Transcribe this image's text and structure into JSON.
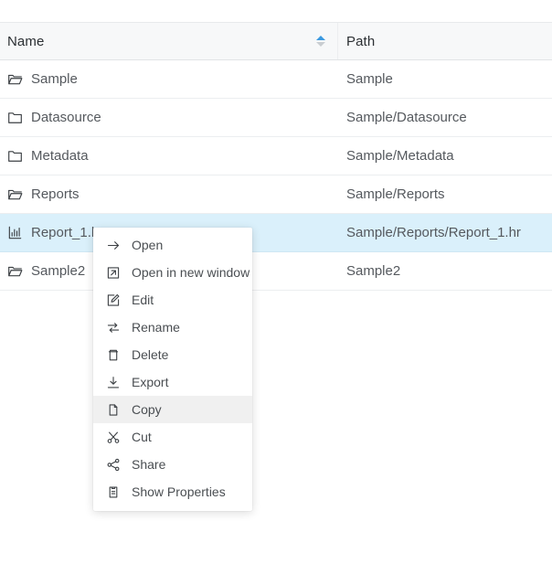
{
  "table": {
    "columns": [
      {
        "key": "name",
        "label": "Name",
        "sort_icon": "sort-asc-desc-icon",
        "sort_active_direction": "asc"
      },
      {
        "key": "path",
        "label": "Path"
      }
    ],
    "rows": [
      {
        "icon": "folder-open-icon",
        "indent": 0,
        "name": "Sample",
        "path": "Sample",
        "selected": false
      },
      {
        "icon": "folder-icon",
        "indent": 1,
        "name": "Datasource",
        "path": "Sample/Datasource",
        "selected": false
      },
      {
        "icon": "folder-icon",
        "indent": 1,
        "name": "Metadata",
        "path": "Sample/Metadata",
        "selected": false
      },
      {
        "icon": "folder-open-icon",
        "indent": 1,
        "name": "Reports",
        "path": "Sample/Reports",
        "selected": false
      },
      {
        "icon": "report-chart-icon",
        "indent": 2,
        "name": "Report_1.hr",
        "path": "Sample/Reports/Report_1.hr",
        "selected": true
      },
      {
        "icon": "folder-open-icon",
        "indent": 0,
        "name": "Sample2",
        "path": "Sample2",
        "selected": false
      }
    ]
  },
  "context_menu": {
    "items": [
      {
        "icon": "arrow-right-icon",
        "label": "Open",
        "hovered": false
      },
      {
        "icon": "open-new-window-icon",
        "label": "Open in new window",
        "hovered": false
      },
      {
        "icon": "edit-pencil-icon",
        "label": "Edit",
        "hovered": false
      },
      {
        "icon": "rename-icon",
        "label": "Rename",
        "hovered": false
      },
      {
        "icon": "trash-icon",
        "label": "Delete",
        "hovered": false
      },
      {
        "icon": "export-download-icon",
        "label": "Export",
        "hovered": false
      },
      {
        "icon": "copy-icon",
        "label": "Copy",
        "hovered": true
      },
      {
        "icon": "scissors-icon",
        "label": "Cut",
        "hovered": false
      },
      {
        "icon": "share-icon",
        "label": "Share",
        "hovered": false
      },
      {
        "icon": "properties-icon",
        "label": "Show Properties",
        "hovered": false
      }
    ]
  },
  "colors": {
    "selected_row": "#daf0fb",
    "header_bg": "#f7f8f9",
    "sort_active": "#3b99e0",
    "sort_inactive": "#c9cdd1",
    "menu_hover": "#f0f0f0",
    "text": "#55595e"
  }
}
